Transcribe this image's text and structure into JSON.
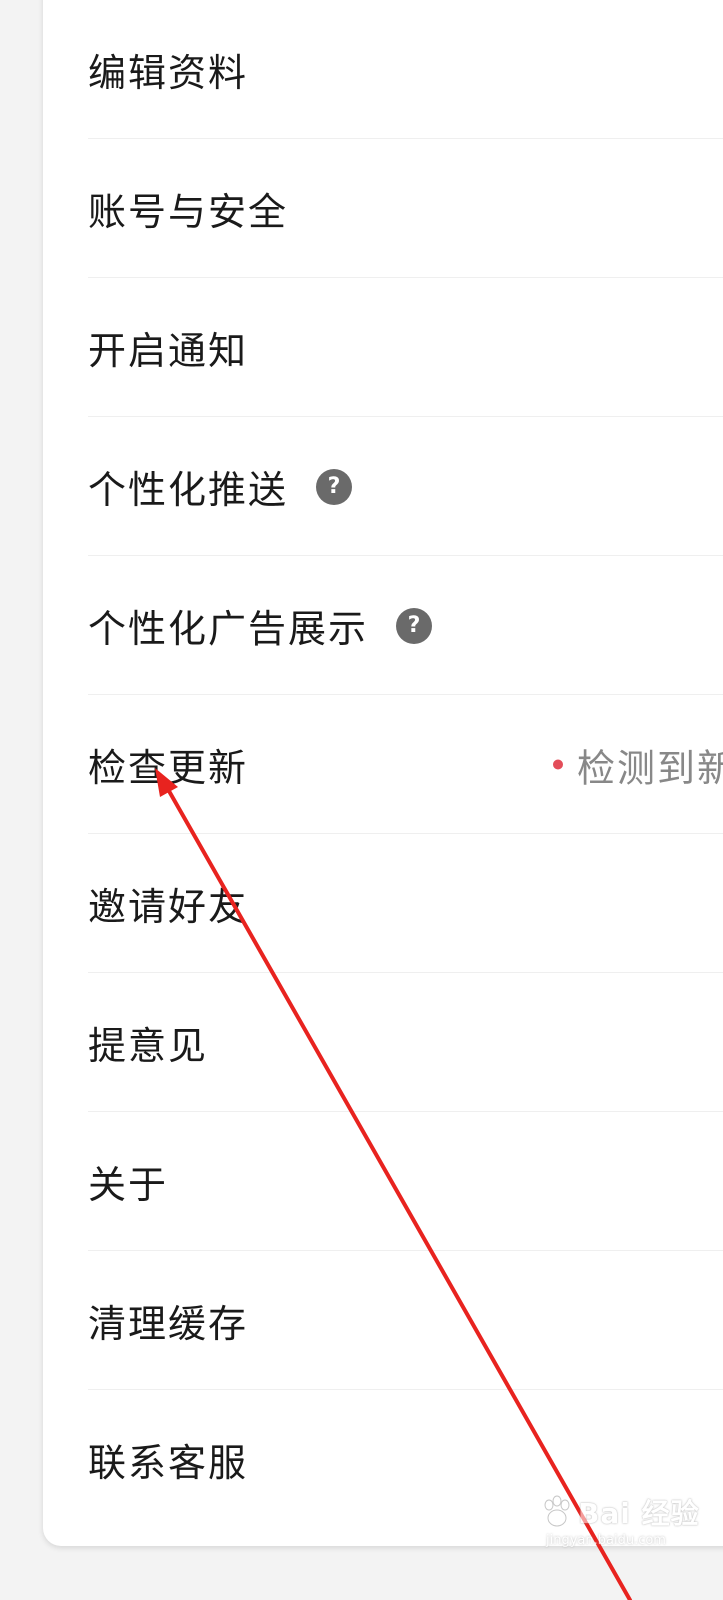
{
  "menu": {
    "items": [
      {
        "label": "编辑资料",
        "help": false
      },
      {
        "label": "账号与安全",
        "help": false
      },
      {
        "label": "开启通知",
        "help": false
      },
      {
        "label": "个性化推送",
        "help": true,
        "help_glyph": "?"
      },
      {
        "label": "个性化广告展示",
        "help": true,
        "help_glyph": "?"
      },
      {
        "label": "检查更新",
        "help": false,
        "status": "检测到新"
      },
      {
        "label": "邀请好友",
        "help": false
      },
      {
        "label": "提意见",
        "help": false
      },
      {
        "label": "关于",
        "help": false
      },
      {
        "label": "清理缓存",
        "help": false
      },
      {
        "label": "联系客服",
        "help": false
      }
    ]
  },
  "watermark": {
    "text": "Bai 经验",
    "url": "jingyan.baidu.com"
  },
  "colors": {
    "annotation_arrow": "#e8231f",
    "status_dot": "#e34d59",
    "help_icon_bg": "#6a6a6a"
  }
}
